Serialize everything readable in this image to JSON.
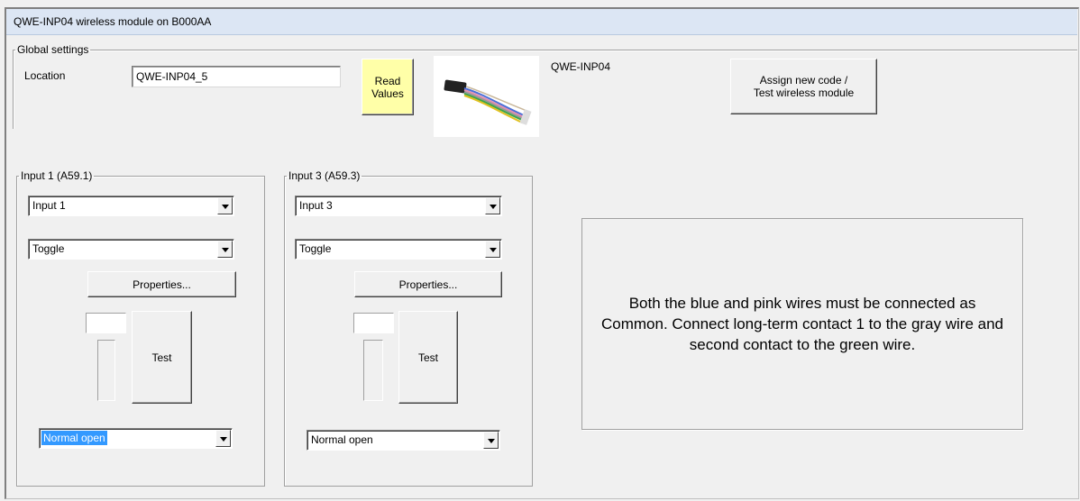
{
  "window": {
    "title": "QWE-INP04 wireless module on B000AA"
  },
  "global_settings": {
    "legend": "Global settings",
    "location_label": "Location",
    "location_value": "QWE-INP04_5",
    "read_values_line1": "Read",
    "read_values_line2": "Values",
    "module_name": "QWE-INP04",
    "assign_line1": "Assign new code /",
    "assign_line2": "Test wireless module"
  },
  "inputs": [
    {
      "legend": "Input 1 (A59.1)",
      "name": "Input 1",
      "mode": "Toggle",
      "properties_label": "Properties...",
      "test_label": "Test",
      "contact": "Normal open"
    },
    {
      "legend": "Input 3 (A59.3)",
      "name": "Input 3",
      "mode": "Toggle",
      "properties_label": "Properties...",
      "test_label": "Test",
      "contact": "Normal open"
    }
  ],
  "info_text": "Both the blue and pink wires must be connected as Common. Connect long-term contact 1 to the gray wire and second contact to the green wire.",
  "icons": {
    "module": "wire-harness-image",
    "dropdown": "chevron-down-icon"
  }
}
